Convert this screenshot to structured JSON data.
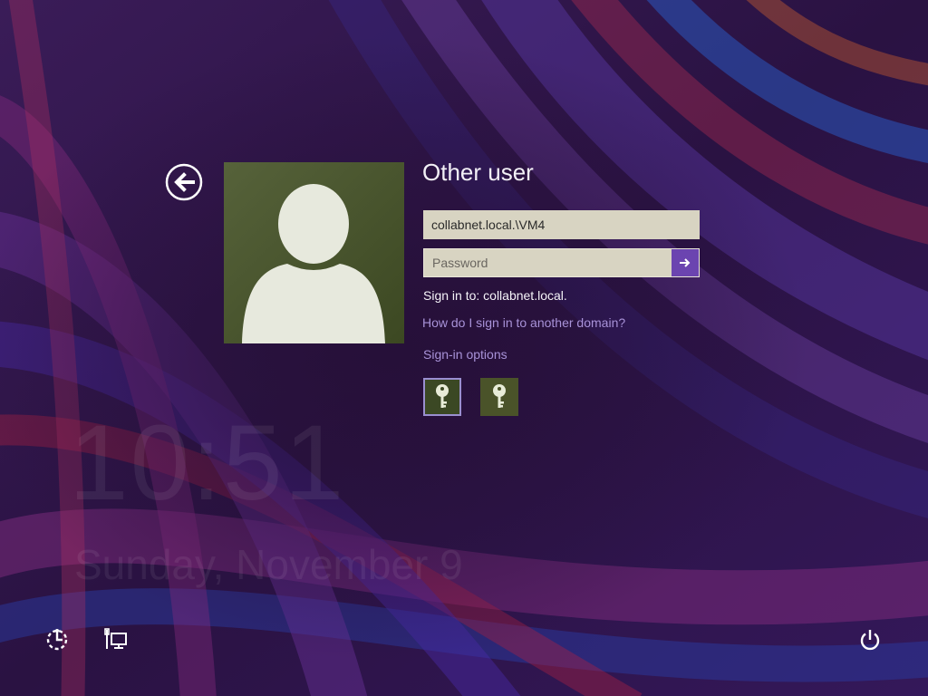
{
  "clock": {
    "time": "10:51",
    "date": "Sunday, November 9"
  },
  "signin": {
    "title": "Other user",
    "username_value": "collabnet.local.\\VM4",
    "password_placeholder": "Password",
    "signin_to": "Sign in to: collabnet.local.",
    "other_domain_link": "How do I sign in to another domain?",
    "options_label": "Sign-in options"
  },
  "icons": {
    "back": "back-arrow-icon",
    "user": "user-silhouette-icon",
    "submit": "arrow-right-icon",
    "key_option_1": "key-icon",
    "key_option_2": "key-icon",
    "ease_of_access": "ease-of-access-icon",
    "network": "network-icon",
    "power": "power-icon"
  },
  "colors": {
    "background": "#2a1244",
    "accent": "#6b44b0",
    "link": "#a892d8",
    "tile": "#4b5a2c"
  }
}
